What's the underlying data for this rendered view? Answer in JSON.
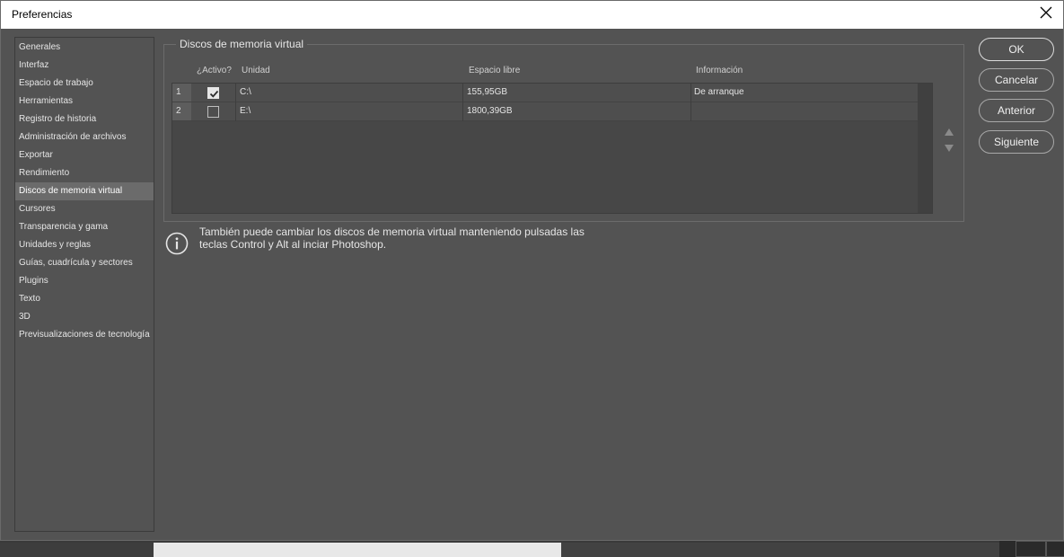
{
  "window": {
    "title": "Preferencias"
  },
  "sidebar": {
    "items": [
      {
        "label": "Generales"
      },
      {
        "label": "Interfaz"
      },
      {
        "label": "Espacio de trabajo"
      },
      {
        "label": "Herramientas"
      },
      {
        "label": "Registro de historia"
      },
      {
        "label": "Administración de archivos"
      },
      {
        "label": "Exportar"
      },
      {
        "label": "Rendimiento"
      },
      {
        "label": "Discos de memoria virtual",
        "active": true
      },
      {
        "label": "Cursores"
      },
      {
        "label": "Transparencia y gama"
      },
      {
        "label": "Unidades y reglas"
      },
      {
        "label": "Guías, cuadrícula y sectores"
      },
      {
        "label": "Plugins"
      },
      {
        "label": "Texto"
      },
      {
        "label": "3D"
      },
      {
        "label": "Previsualizaciones de tecnología"
      }
    ]
  },
  "scratch": {
    "group_title": "Discos de memoria virtual",
    "columns": {
      "active": "¿Activo?",
      "drive": "Unidad",
      "free": "Espacio libre",
      "info": "Información"
    },
    "rows": [
      {
        "num": "1",
        "active": true,
        "drive": "C:\\",
        "free": "155,95GB",
        "info": "De arranque"
      },
      {
        "num": "2",
        "active": false,
        "drive": "E:\\",
        "free": "1800,39GB",
        "info": ""
      }
    ],
    "info_line1": "También puede cambiar los discos de memoria virtual manteniendo pulsadas las",
    "info_line2": "teclas Control y Alt al inciar Photoshop."
  },
  "buttons": {
    "ok": "OK",
    "cancel": "Cancelar",
    "previous": "Anterior",
    "next": "Siguiente"
  },
  "icons": {
    "close": "close-icon",
    "info": "info-icon",
    "up": "arrow-up-icon",
    "down": "arrow-down-icon",
    "check": "checkmark-icon"
  }
}
